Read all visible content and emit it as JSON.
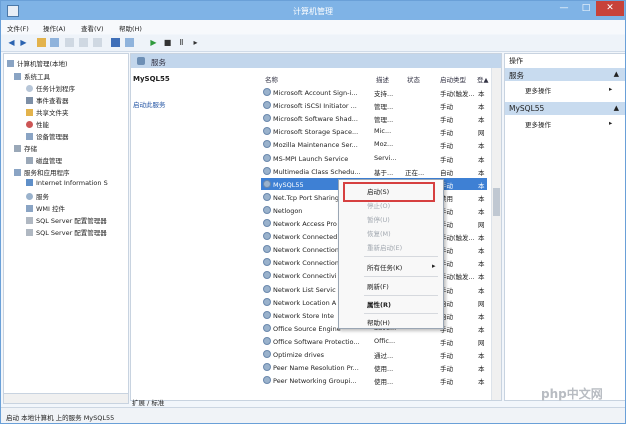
{
  "window": {
    "title": "计算机管理",
    "min": "—",
    "max": "□",
    "close": "✕"
  },
  "menu": [
    "文件(F)",
    "操作(A)",
    "查看(V)",
    "帮助(H)"
  ],
  "tree": [
    "计算机管理(本地)",
    "系统工具",
    "任务计划程序",
    "事件查看器",
    "共享文件夹",
    "性能",
    "设备管理器",
    "存储",
    "磁盘管理",
    "服务和应用程序",
    "Internet Information S",
    "服务",
    "WMI 控件",
    "SQL Server 配置管理器",
    "SQL Server 配置管理器"
  ],
  "center": {
    "header": "服务",
    "detail_title": "MySQL55",
    "detail_link": "启动此服务",
    "columns": [
      "名称",
      "描述",
      "状态",
      "启动类型",
      "登▲"
    ]
  },
  "services": [
    {
      "name": "Microsoft Account Sign-i...",
      "desc": "支持...",
      "status": "",
      "startup": "手动(触发...",
      "logon": "本"
    },
    {
      "name": "Microsoft iSCSI Initiator ...",
      "desc": "管理...",
      "status": "",
      "startup": "手动",
      "logon": "本"
    },
    {
      "name": "Microsoft Software Shad...",
      "desc": "管理...",
      "status": "",
      "startup": "手动",
      "logon": "本"
    },
    {
      "name": "Microsoft Storage Space...",
      "desc": "Mic...",
      "status": "",
      "startup": "手动",
      "logon": "网"
    },
    {
      "name": "Mozilla Maintenance Ser...",
      "desc": "Moz...",
      "status": "",
      "startup": "手动",
      "logon": "本"
    },
    {
      "name": "MS-MPI Launch Service",
      "desc": "Servi...",
      "status": "",
      "startup": "手动",
      "logon": "本"
    },
    {
      "name": "Multimedia Class Schedu...",
      "desc": "基于...",
      "status": "正在...",
      "startup": "自动",
      "logon": "本"
    },
    {
      "name": "MySQL55",
      "desc": "",
      "status": "",
      "startup": "手动",
      "logon": "本"
    },
    {
      "name": "Net.Tcp Port Sharing",
      "desc": "",
      "status": "",
      "startup": "禁用",
      "logon": "本"
    },
    {
      "name": "Netlogon",
      "desc": "",
      "status": "",
      "startup": "手动",
      "logon": "本"
    },
    {
      "name": "Network Access Pro",
      "desc": "",
      "status": "",
      "startup": "手动",
      "logon": "网"
    },
    {
      "name": "Network Connected",
      "desc": "",
      "status": "",
      "startup": "手动(触发...",
      "logon": "本"
    },
    {
      "name": "Network Connection",
      "desc": "",
      "status": "",
      "startup": "手动",
      "logon": "本"
    },
    {
      "name": "Network Connection",
      "desc": "",
      "status": "",
      "startup": "手动",
      "logon": "本"
    },
    {
      "name": "Network Connectivi",
      "desc": "",
      "status": "",
      "startup": "手动(触发...",
      "logon": "本"
    },
    {
      "name": "Network List Servic",
      "desc": "",
      "status": "",
      "startup": "手动",
      "logon": "本"
    },
    {
      "name": "Network Location A",
      "desc": "",
      "status": "",
      "startup": "自动",
      "logon": "网"
    },
    {
      "name": "Network Store Inte",
      "desc": "",
      "status": "",
      "startup": "自动",
      "logon": "本"
    },
    {
      "name": "Office Source Engine",
      "desc": "Save...",
      "status": "",
      "startup": "手动",
      "logon": "本"
    },
    {
      "name": "Office Software Protectio...",
      "desc": "Offic...",
      "status": "",
      "startup": "手动",
      "logon": "网"
    },
    {
      "name": "Optimize drives",
      "desc": "通过...",
      "status": "",
      "startup": "手动",
      "logon": "本"
    },
    {
      "name": "Peer Name Resolution Pr...",
      "desc": "使用...",
      "status": "",
      "startup": "手动",
      "logon": "本"
    },
    {
      "name": "Peer Networking Groupi...",
      "desc": "使用...",
      "status": "",
      "startup": "手动",
      "logon": "本"
    }
  ],
  "context_menu": {
    "start": "启动(S)",
    "stop": "停止(O)",
    "pause": "暂停(U)",
    "resume": "恢复(M)",
    "restart": "重新启动(E)",
    "all_tasks": "所有任务(K)",
    "arrow": "▸",
    "refresh": "刷新(F)",
    "properties": "属性(R)",
    "help": "帮助(H)"
  },
  "actions": {
    "label": "操作",
    "section1": "服务",
    "section2": "MySQL55",
    "more1": "更多操作",
    "more2": "更多操作",
    "arrow_up": "▲",
    "arrow_right": "▸"
  },
  "tabs": "扩展 / 标准",
  "status": "启动 本地计算机 上的服务 MySQL55",
  "watermark": "php中文网",
  "colors": {
    "selection": "#3e80d4",
    "highlight_border": "#d64040",
    "title_bar": "#7fb3e6"
  }
}
